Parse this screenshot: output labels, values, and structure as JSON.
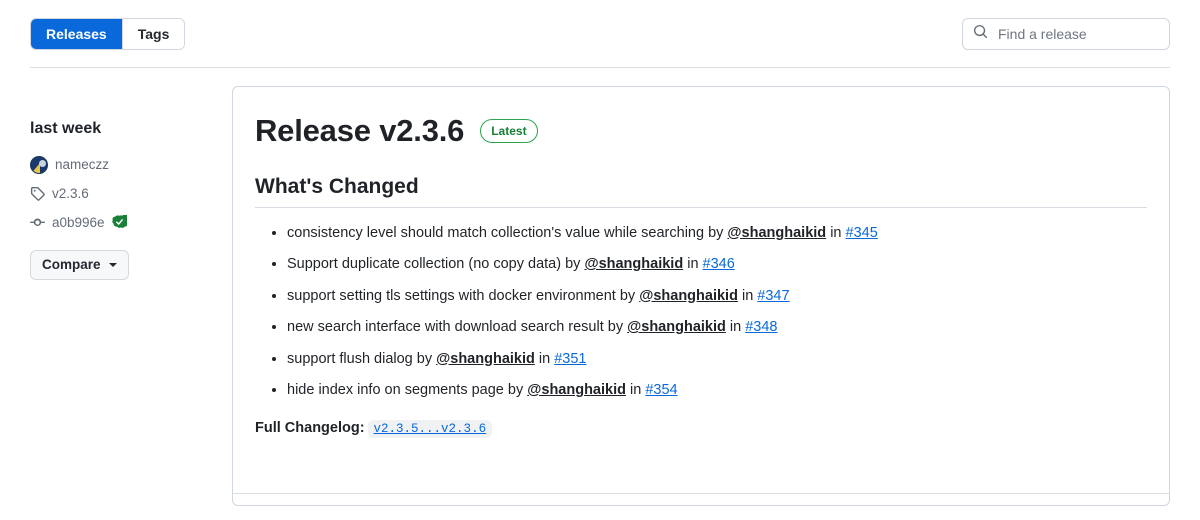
{
  "header": {
    "tabs": [
      {
        "label": "Releases",
        "active": true
      },
      {
        "label": "Tags",
        "active": false
      }
    ],
    "search": {
      "placeholder": "Find a release",
      "value": ""
    }
  },
  "sidebar": {
    "date": "last week",
    "author": "nameczz",
    "tag": "v2.3.6",
    "commit": "a0b996e",
    "verified_label": "Verified",
    "compare_label": "Compare"
  },
  "release": {
    "title": "Release v2.3.6",
    "badge": "Latest",
    "section_heading": "What's Changed",
    "changes": [
      {
        "text_before": "consistency level should match collection's value while searching by ",
        "mention": "@shanghaikid",
        "text_middle": " in ",
        "pr": "#345"
      },
      {
        "text_before": "Support duplicate collection (no copy data) by ",
        "mention": "@shanghaikid",
        "text_middle": " in ",
        "pr": "#346"
      },
      {
        "text_before": "support setting tls settings with docker environment by ",
        "mention": "@shanghaikid",
        "text_middle": " in ",
        "pr": "#347"
      },
      {
        "text_before": "new search interface with download search result by ",
        "mention": "@shanghaikid",
        "text_middle": " in ",
        "pr": "#348"
      },
      {
        "text_before": "support flush dialog by ",
        "mention": "@shanghaikid",
        "text_middle": " in ",
        "pr": "#351"
      },
      {
        "text_before": "hide index info on segments page by ",
        "mention": "@shanghaikid",
        "text_middle": " in ",
        "pr": "#354"
      }
    ],
    "full_changelog_label": "Full Changelog:",
    "full_changelog_link": "v2.3.5...v2.3.6"
  },
  "colors": {
    "accent": "#0969da",
    "success": "#1a7f37",
    "border": "#d0d7de",
    "muted": "#636c76"
  }
}
